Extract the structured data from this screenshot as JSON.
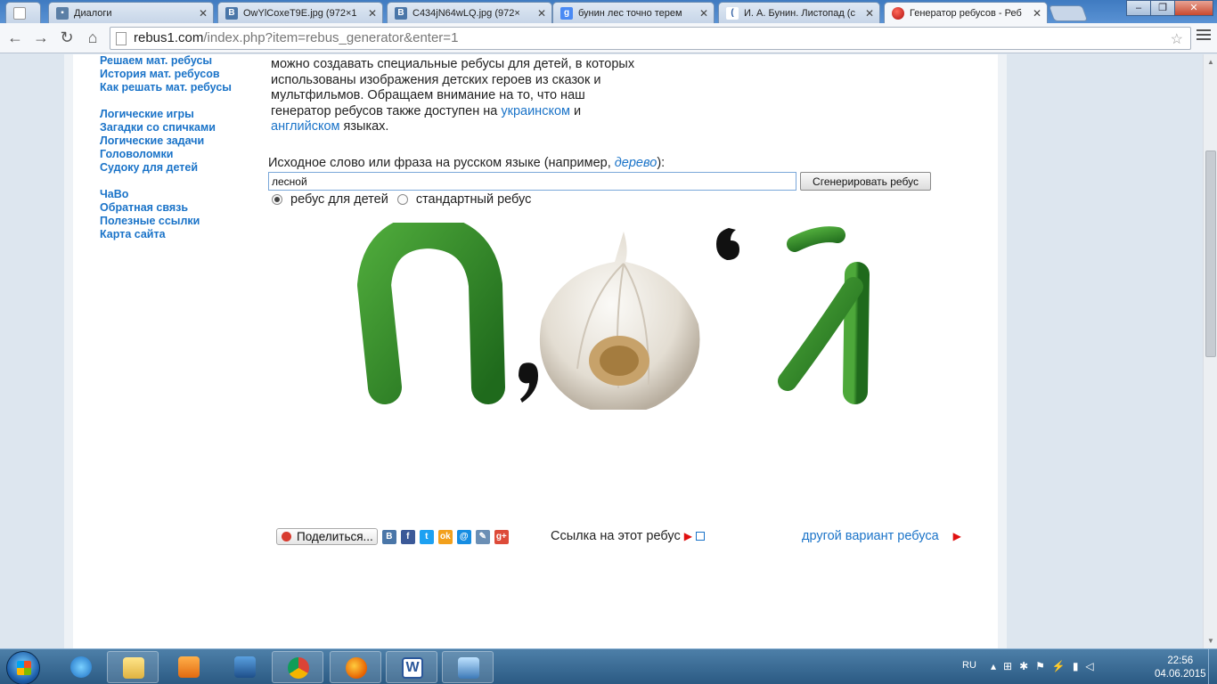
{
  "browser": {
    "tabs": [
      {
        "title": "",
        "icon": "blank-page-icon",
        "active": false
      },
      {
        "title": "Диалоги",
        "icon": "chat-icon",
        "active": false
      },
      {
        "title": "OwYlCoxeT9E.jpg (972×1",
        "icon": "vk-icon",
        "active": false
      },
      {
        "title": "C434jN64wLQ.jpg (972×",
        "icon": "vk-icon",
        "active": false
      },
      {
        "title": "бунин лес точно терем",
        "icon": "google-icon",
        "active": false
      },
      {
        "title": "И. А. Бунин. Листопад (с",
        "icon": "moon-icon",
        "active": false
      },
      {
        "title": "Генератор ребусов - Реб",
        "icon": "rebus-site-icon",
        "active": true
      }
    ],
    "url_host": "rebus1.com",
    "url_path": "/index.php?item=rebus_generator&enter=1"
  },
  "sidebar": {
    "group1": [
      "Решаем мат. ребусы",
      "История мат. ребусов",
      "Как решать мат. ребусы"
    ],
    "group2": [
      "Логические игры",
      "Загадки со спичками",
      "Логические задачи",
      "Головоломки",
      "Судоку для детей"
    ],
    "group3": [
      "ЧаВо",
      "Обратная связь",
      "Полезные ссылки",
      "Карта сайта"
    ]
  },
  "intro": {
    "line1": "можно создавать специальные ребусы для детей, в которых",
    "line2": "использованы изображения детских героев из сказок и",
    "line3": "мультфильмов. Обращаем внимание на то, что наш",
    "line4_pre": "генератор ребусов также доступен на ",
    "link_ukrainian": "украинском",
    "line4_post": " и",
    "link_english": "английском",
    "line5_post": " языках."
  },
  "form": {
    "prompt_pre": "Исходное слово или фраза на русском языке (например, ",
    "prompt_example": "дерево",
    "prompt_post": "):",
    "input_value": "лесной",
    "generate_label": "Сгенерировать ребус",
    "radio_kids": "ребус для детей",
    "radio_standard": "стандартный ребус",
    "selected": "kids"
  },
  "rebus": {
    "letter1": "П",
    "comma1": ",",
    "picture": "garlic",
    "comma2_inverted": ",",
    "letter2": "Й"
  },
  "share": {
    "share_label": "Поделиться...",
    "social_icons": [
      "В",
      "f",
      "t",
      "ok",
      "@",
      "✎",
      "g+"
    ],
    "link_label": "Ссылка на этот ребус",
    "other_variant": "другой вариант ребуса"
  },
  "taskbar": {
    "lang": "RU",
    "time": "22:56",
    "date": "04.06.2015"
  }
}
